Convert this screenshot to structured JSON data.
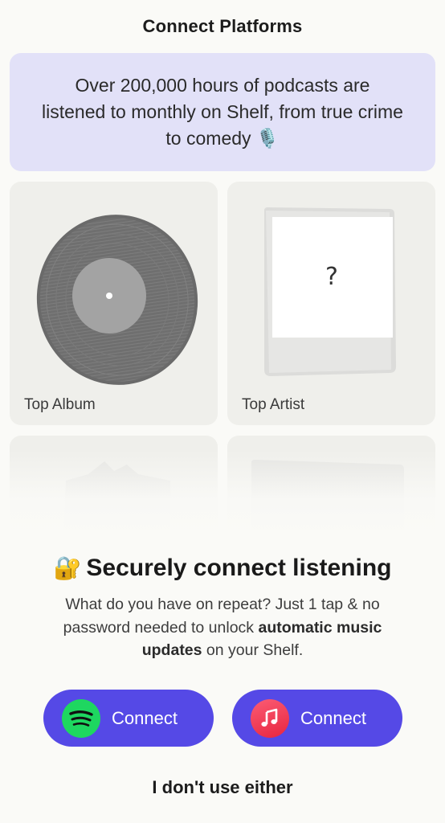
{
  "header": {
    "title": "Connect Platforms"
  },
  "banner": {
    "text": "Over 200,000 hours of podcasts are listened to monthly on Shelf, from true crime to comedy 🎙️"
  },
  "cards": [
    {
      "label": "Top Album",
      "image": "vinyl-record"
    },
    {
      "label": "Top Artist",
      "image": "photo-frame",
      "placeholder": "?"
    },
    {
      "label": "",
      "image": "torn-paper"
    },
    {
      "label": "",
      "image": "card"
    }
  ],
  "sheet": {
    "emoji": "🔐",
    "title": "Securely connect listening",
    "desc_prefix": "What do you have on repeat? Just 1 tap & no password needed to unlock ",
    "desc_bold": "automatic music updates",
    "desc_suffix": " on your Shelf."
  },
  "buttons": {
    "spotify": {
      "label": "Connect",
      "icon": "spotify-icon",
      "color": "#1ed760"
    },
    "apple": {
      "label": "Connect",
      "icon": "apple-music-icon",
      "color": "#fb5c74"
    },
    "accent": "#5549e6"
  },
  "skip": {
    "label": "I don't use either"
  }
}
